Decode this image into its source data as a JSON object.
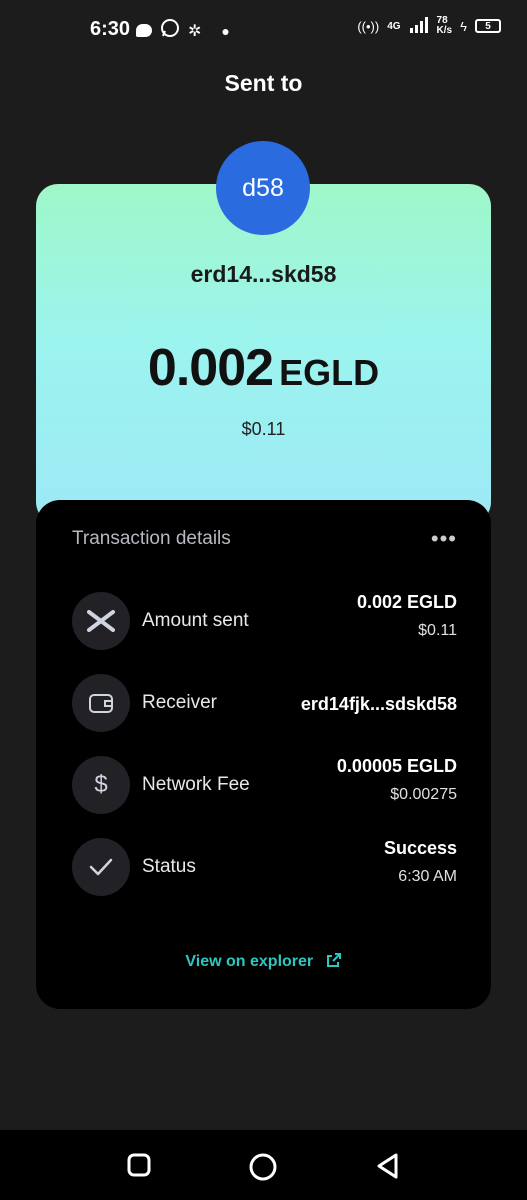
{
  "status_bar": {
    "time": "6:30",
    "network": "4G",
    "speed_value": "78",
    "speed_unit": "K/s",
    "battery": "5"
  },
  "header": {
    "title": "Sent to"
  },
  "recipient_card": {
    "avatar_text": "d58",
    "address_short": "erd14...skd58",
    "amount_value": "0.002",
    "amount_currency": "EGLD",
    "amount_usd": "$0.11"
  },
  "details": {
    "title": "Transaction details",
    "more_label": "•••",
    "rows": [
      {
        "label": "Amount sent",
        "value": "0.002 EGLD",
        "sub": "$0.11",
        "icon": "multiversx-icon"
      },
      {
        "label": "Receiver",
        "value": "erd14fjk...sdskd58",
        "sub": "",
        "icon": "wallet-icon"
      },
      {
        "label": "Network Fee",
        "value": "0.00005 EGLD",
        "sub": "$0.00275",
        "icon": "dollar-icon"
      },
      {
        "label": "Status",
        "value": "Success",
        "sub": "6:30 AM",
        "icon": "check-icon"
      }
    ],
    "explorer_link": "View on explorer"
  },
  "colors": {
    "card_gradient_top": "#9ff7c8",
    "card_gradient_bottom": "#9de9f5",
    "avatar_bg": "#2a6bdf",
    "link": "#2fc6c0",
    "background": "#1c1c1c"
  }
}
